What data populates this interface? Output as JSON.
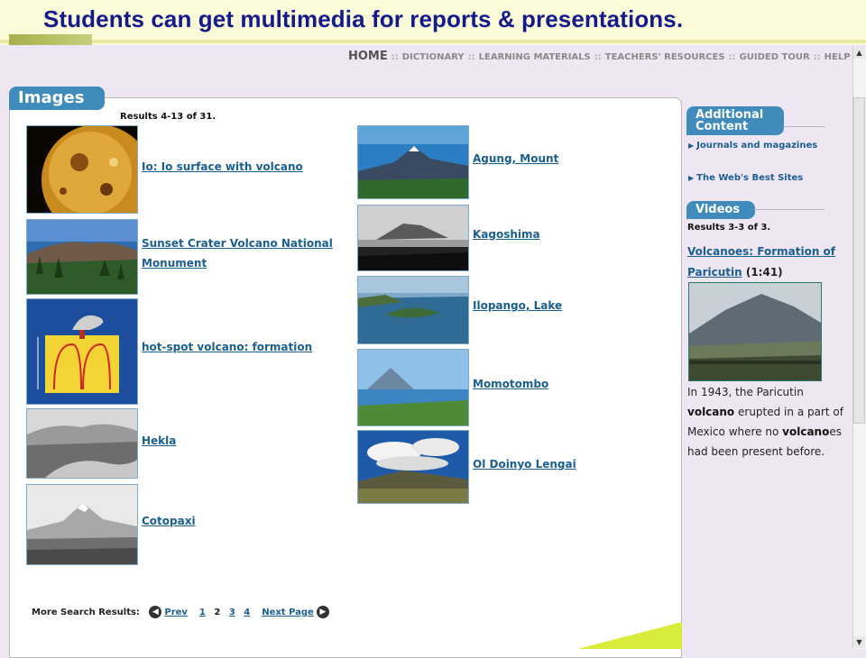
{
  "banner": {
    "headline": "Students can get multimedia for reports & presentations."
  },
  "topnav": {
    "home": "HOME",
    "items": [
      "DICTIONARY",
      "LEARNING MATERIALS",
      "TEACHERS' RESOURCES",
      "GUIDED TOUR",
      "HELP"
    ],
    "separator": "::"
  },
  "images_panel": {
    "tab_label": "Images",
    "results_text": "Results 4-13 of 31.",
    "left_column": [
      {
        "label": "Io: Io surface with volcano",
        "icon": "io-planet-thumbnail"
      },
      {
        "label": "Sunset Crater Volcano National Monument",
        "icon": "sunset-crater-thumbnail"
      },
      {
        "label": "hot-spot volcano: formation",
        "icon": "hot-spot-diagram-thumbnail"
      },
      {
        "label": "Hekla",
        "icon": "hekla-thumbnail"
      },
      {
        "label": "Cotopaxi",
        "icon": "cotopaxi-thumbnail"
      }
    ],
    "right_column": [
      {
        "label": "Agung, Mount",
        "icon": "agung-thumbnail"
      },
      {
        "label": "Kagoshima",
        "icon": "kagoshima-thumbnail"
      },
      {
        "label": "Ilopango, Lake",
        "icon": "ilopango-thumbnail"
      },
      {
        "label": "Momotombo",
        "icon": "momotombo-thumbnail"
      },
      {
        "label": "Ol Doinyo Lengai",
        "icon": "ol-doinyo-lengai-thumbnail"
      }
    ],
    "pagination": {
      "label": "More Search Results:",
      "prev": "Prev",
      "pages": [
        "1",
        "2",
        "3",
        "4"
      ],
      "current": "2",
      "next": "Next Page"
    }
  },
  "sidebar": {
    "additional_tab_line1": "Additional",
    "additional_tab_line2": "Content",
    "links": [
      "Journals and magazines",
      "The Web's Best Sites"
    ],
    "videos_tab": "Videos",
    "videos_results": "Results 3-3 of 3.",
    "video_title": "Volcanoes: Formation of Paricutin",
    "video_duration": "(1:41)",
    "caption_parts": {
      "p1": "In 1943, the Paricutin ",
      "b1": "volcano",
      "p2": " erupted in a part of Mexico where no ",
      "b2": "volcano",
      "p3": "es had been present before."
    }
  },
  "colors": {
    "accent": "#3f8cbc",
    "link": "#1a5f8f",
    "headline": "#151a8a",
    "background": "#efe6f3"
  }
}
